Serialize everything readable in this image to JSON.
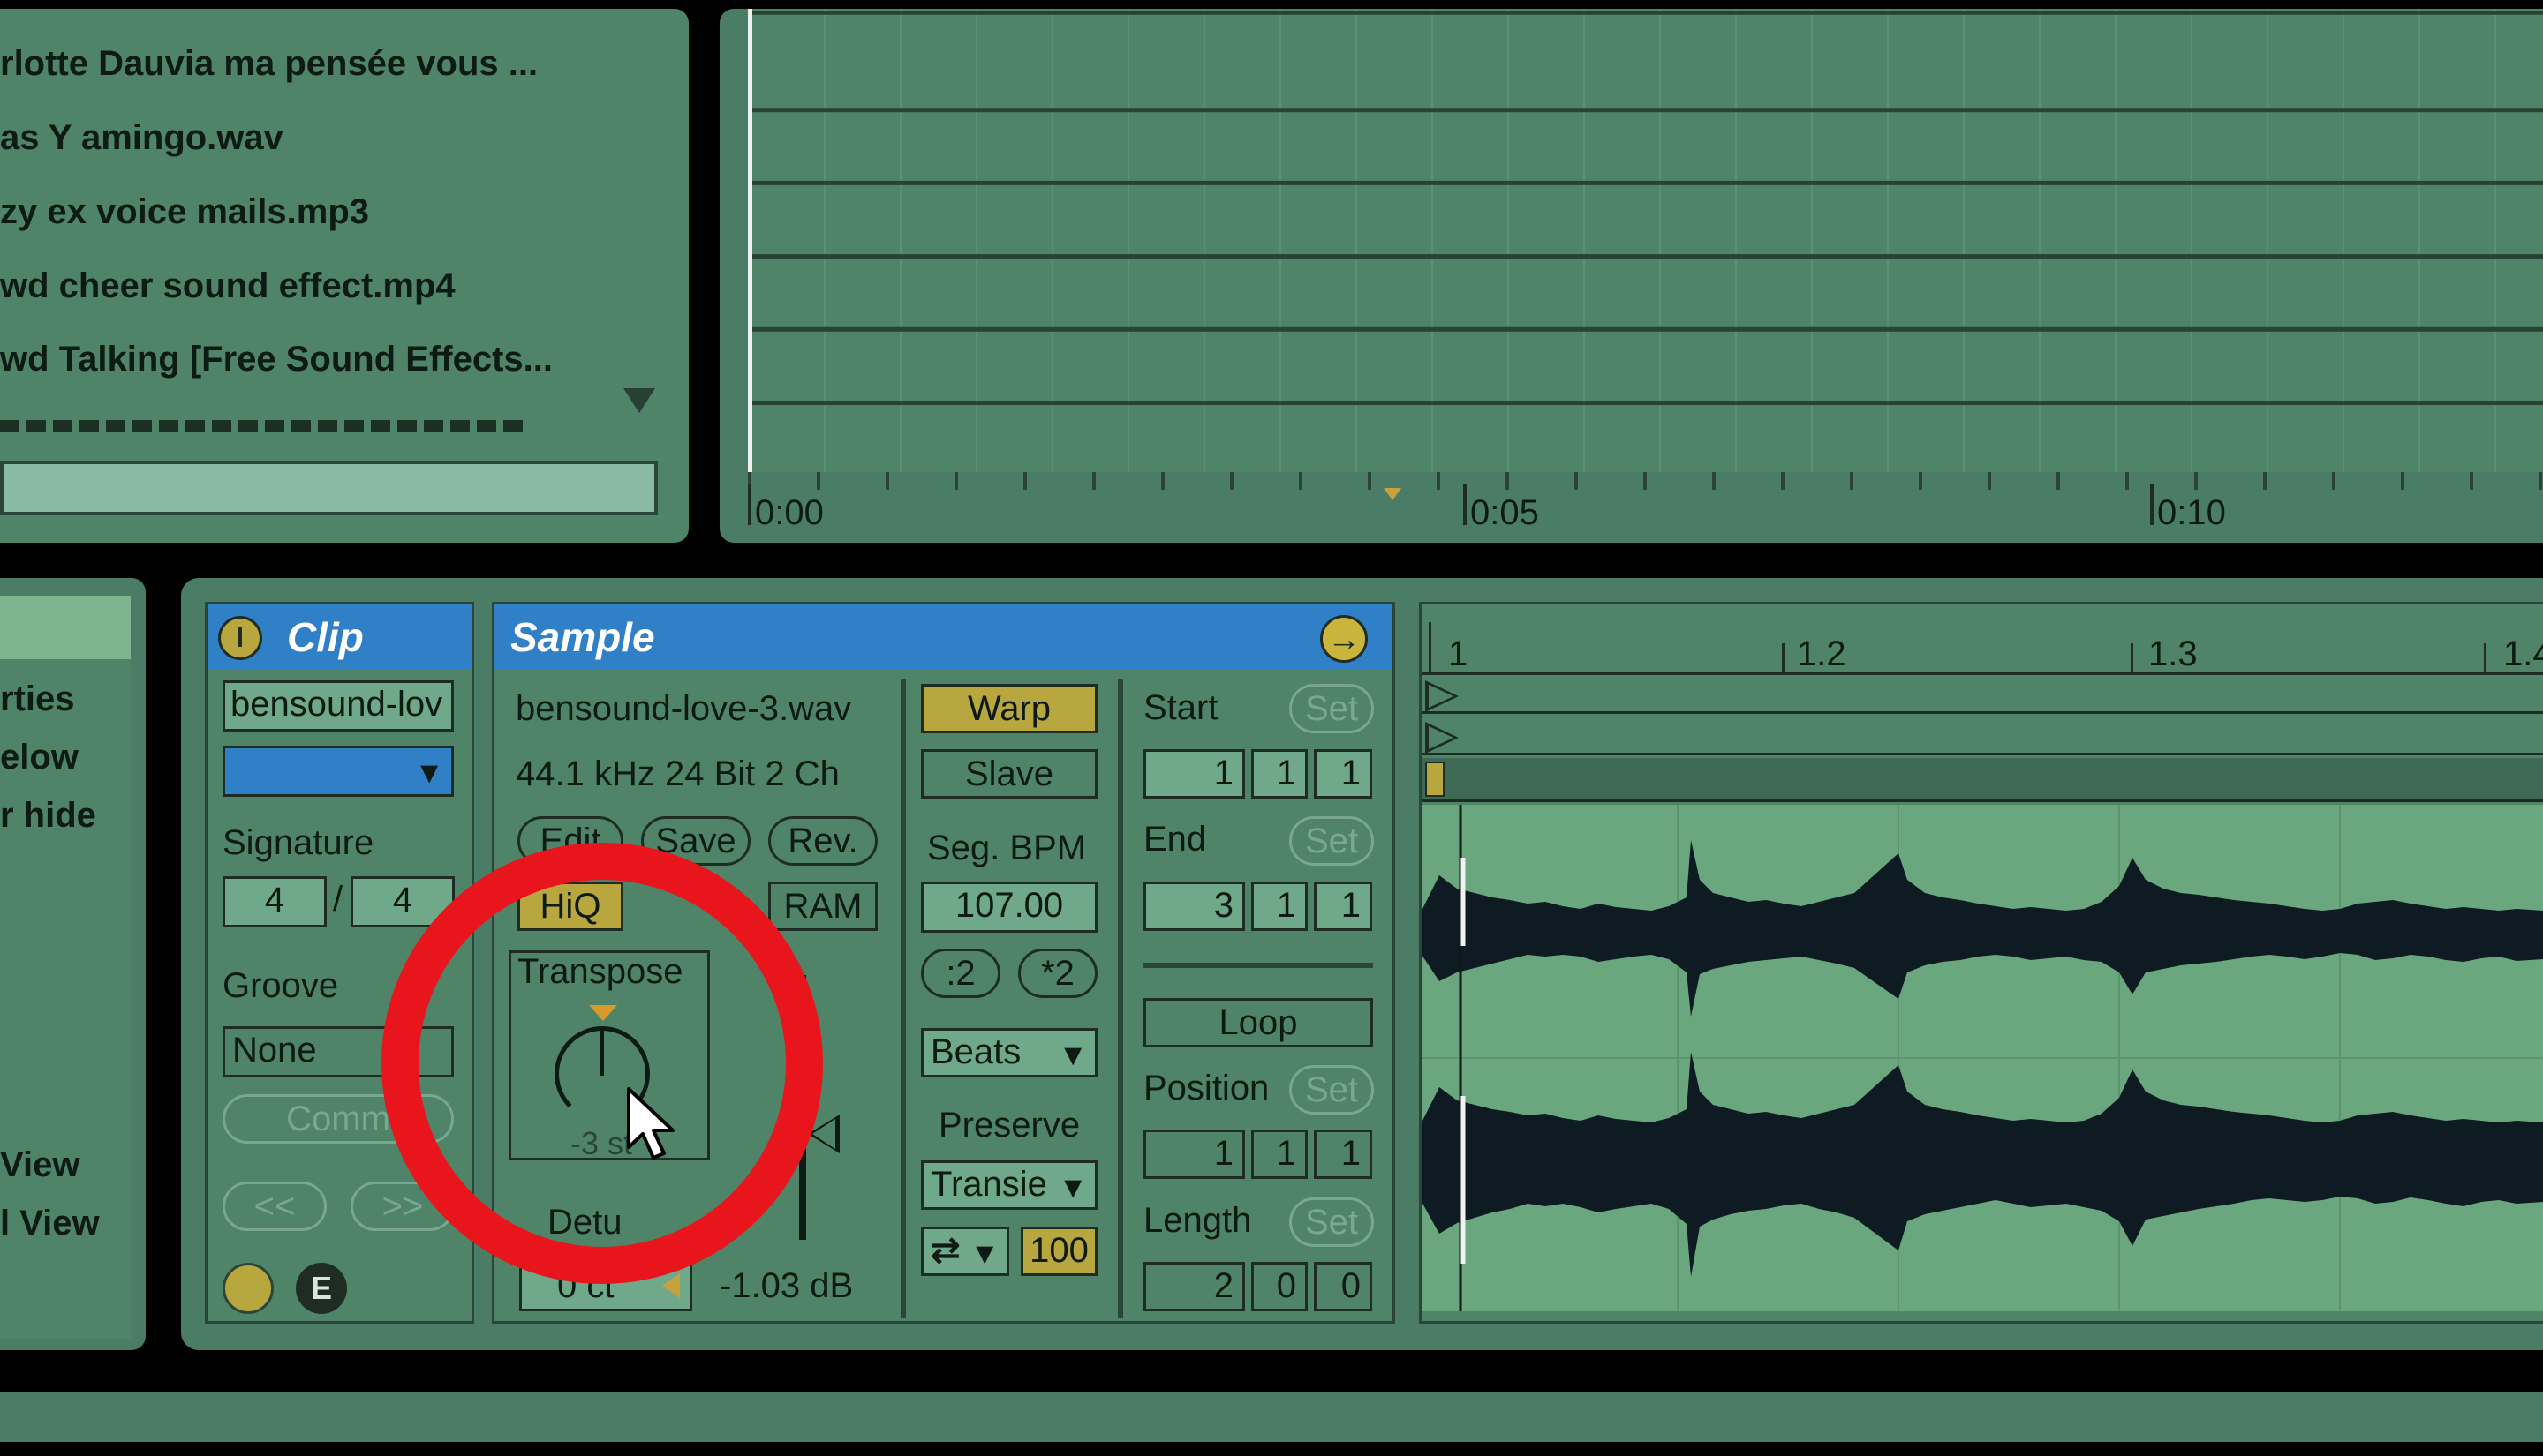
{
  "browser": {
    "items": [
      "rlotte Dauvia  ma pensée vous ...",
      "as Y amingo.wav",
      "zy ex voice mails.mp3",
      "wd cheer sound effect.mp4",
      "wd Talking [Free Sound Effects..."
    ]
  },
  "arrangement": {
    "time_labels": [
      "0:00",
      "0:05",
      "0:10"
    ]
  },
  "left_info": {
    "lines": [
      "rties",
      "elow",
      "r hide"
    ],
    "view_lines": [
      "View",
      "l View"
    ]
  },
  "clip": {
    "title": "Clip",
    "name_value": "bensound-lov",
    "signature_label": "Signature",
    "sig_num": "4",
    "sig_sep": "/",
    "sig_den": "4",
    "groove_label": "Groove",
    "groove_value": "None",
    "commit_label": "Comm",
    "prev_label": "<<",
    "next_label": ">>",
    "e_label": "E"
  },
  "sample": {
    "title": "Sample",
    "filename": "bensound-love-3.wav",
    "format": "44.1 kHz 24 Bit 2 Ch",
    "edit": "Edit",
    "save": "Save",
    "rev": "Rev.",
    "hiq": "HiQ",
    "ram": "RAM",
    "transpose_label": "Transpose",
    "transpose_value": "-3 st",
    "detune_label": "Detu",
    "detune_value": "0 ct",
    "gain_value": "-1.03 dB",
    "warp": "Warp",
    "slave": "Slave",
    "seg_bpm_label": "Seg. BPM",
    "bpm_value": "107.00",
    "half": ":2",
    "double": "*2",
    "warp_mode": "Beats",
    "preserve_label": "Preserve",
    "preserve_value": "Transie",
    "loop_mode_icon": "⇄",
    "envelope_value": "100",
    "start_label": "Start",
    "start_vals": [
      "1",
      "1",
      "1"
    ],
    "end_label": "End",
    "end_vals": [
      "3",
      "1",
      "1"
    ],
    "set_label": "Set",
    "loop_label": "Loop",
    "position_label": "Position",
    "position_vals": [
      "1",
      "1",
      "1"
    ],
    "length_label": "Length",
    "length_vals": [
      "2",
      "0",
      "0"
    ]
  },
  "waveform": {
    "ruler": [
      "1",
      "1.2",
      "1.3",
      "1.4"
    ]
  },
  "colors": {
    "panel": "#4b7d66",
    "header_blue": "#2f80c6",
    "waveform_bg": "#6aa77e",
    "waveform": "#0f1b22",
    "annotation_red": "#e8151d",
    "gold": "#b8a63e"
  },
  "icons": {
    "scroll_down": "triangle-down-icon",
    "arrow_right": "circle-arrow-right-icon",
    "clip_activator": "power-icon",
    "cursor": "mouse-pointer-icon"
  }
}
